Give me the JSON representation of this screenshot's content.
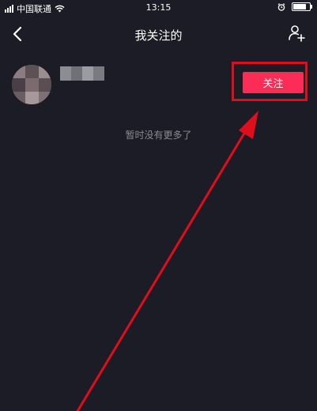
{
  "status_bar": {
    "carrier": "中国联通",
    "time": "13:15",
    "icons": [
      "signal-icon",
      "wifi-icon",
      "alarm-icon",
      "battery-icon"
    ],
    "battery_level": 0.9
  },
  "nav": {
    "title": "我关注的",
    "back_icon": "chevron-left-icon",
    "action_icon": "add-friend-icon"
  },
  "following_list": {
    "items": [
      {
        "name": "",
        "follow_label": "关注"
      }
    ],
    "end_text": "暂时没有更多了"
  },
  "colors": {
    "background": "#1b1c25",
    "follow_button": "#fb2c55",
    "annotation": "#e00e1b",
    "muted_text": "#8a8b93"
  }
}
